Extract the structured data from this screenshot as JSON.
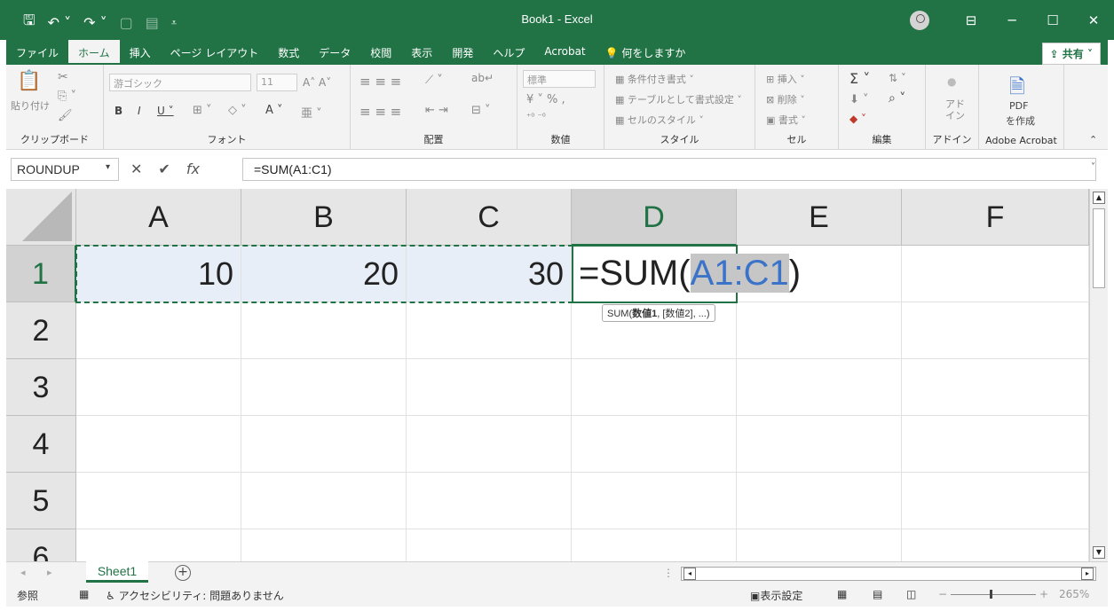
{
  "window": {
    "title": "Book1  -  Excel",
    "minimize": "─",
    "maximize": "☐",
    "close": "✕"
  },
  "qat": {
    "save_icon": "save-icon",
    "undo_icon": "undo-icon",
    "redo_icon": "redo-icon"
  },
  "tabs": [
    {
      "label": "ファイル"
    },
    {
      "label": "ホーム"
    },
    {
      "label": "挿入"
    },
    {
      "label": "ページ レイアウト"
    },
    {
      "label": "数式"
    },
    {
      "label": "データ"
    },
    {
      "label": "校閲"
    },
    {
      "label": "表示"
    },
    {
      "label": "開発"
    },
    {
      "label": "ヘルプ"
    },
    {
      "label": "Acrobat"
    },
    {
      "label": "何をしますか"
    }
  ],
  "share_label": "共有",
  "ribbon": {
    "clipboard": {
      "label": "クリップボード",
      "paste": "貼り付け"
    },
    "font": {
      "label": "フォント",
      "font_name": "游ゴシック",
      "font_size": "11"
    },
    "alignment": {
      "label": "配置"
    },
    "number": {
      "label": "数値",
      "format": "標準"
    },
    "styles": {
      "label": "スタイル",
      "conditional": "条件付き書式",
      "table": "テーブルとして書式設定",
      "cell_style": "セルのスタイル"
    },
    "cells": {
      "label": "セル",
      "insert": "挿入",
      "delete": "削除",
      "format": "書式"
    },
    "editing": {
      "label": "編集"
    },
    "addin": {
      "label": "アドイン",
      "button": "アド\nイン"
    },
    "acrobat": {
      "label": "Adobe Acrobat",
      "pdf": "PDF",
      "create": "を作成"
    }
  },
  "formula_bar": {
    "name_box": "ROUNDUP",
    "formula": "=SUM(A1:C1)"
  },
  "columns": [
    "A",
    "B",
    "C",
    "D",
    "E",
    "F"
  ],
  "rows": [
    "1",
    "2",
    "3",
    "4",
    "5",
    "6"
  ],
  "cells": {
    "A1": "10",
    "B1": "20",
    "C1": "30",
    "D1_prefix": "=SUM(",
    "D1_ref": "A1:C1",
    "D1_suffix": ")"
  },
  "tooltip": {
    "prefix": "SUM(",
    "bold_arg": "数値1",
    "rest": ", [数値2], ...)"
  },
  "sheets": [
    {
      "name": "Sheet1"
    }
  ],
  "status": {
    "mode": "参照",
    "accessibility": "アクセシビリティ: 問題ありません",
    "display_settings": "表示設定",
    "zoom": "265%"
  }
}
